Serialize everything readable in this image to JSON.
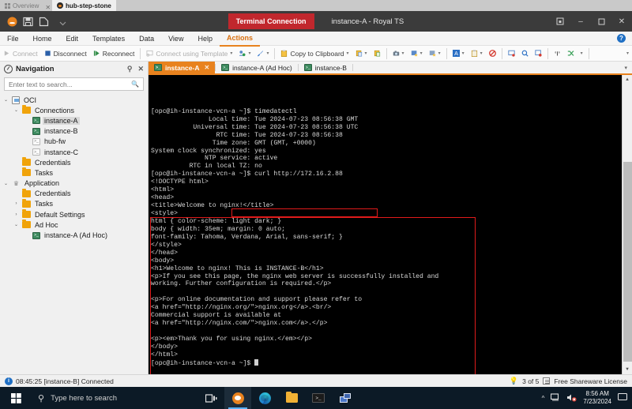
{
  "browser_tabs": [
    {
      "label": "Overview",
      "icon": "grid-icon",
      "active": false
    },
    {
      "label": "hub-step-stone",
      "icon": "app-circle-icon",
      "active": true
    }
  ],
  "window": {
    "connection_badge": "Terminal Connection",
    "title": "instance-A - Royal TS",
    "controls": {
      "restore_down": "❐",
      "minimize": "–",
      "maximize": "❐",
      "close": "✕"
    }
  },
  "quick_access": [
    "royal-ts-logo-icon",
    "save-icon",
    "new-document-icon",
    "customize-caret-icon"
  ],
  "menu": {
    "items": [
      "File",
      "Home",
      "Edit",
      "Templates",
      "Data",
      "View",
      "Help",
      "Actions"
    ],
    "active": "Actions",
    "help_label": "?"
  },
  "ribbon": {
    "connect": "Connect",
    "disconnect": "Disconnect",
    "reconnect": "Reconnect",
    "connect_using_template": "Connect using Template",
    "copy_to_clipboard": "Copy to Clipboard"
  },
  "sidebar": {
    "title": "Navigation",
    "pin_icon": "pin-icon",
    "close_icon": "close-icon",
    "search": {
      "placeholder": "Enter text to search...",
      "value": ""
    },
    "tree": [
      {
        "label": "OCI",
        "depth": 0,
        "chevron": "⌄",
        "icon": "document-icon",
        "selected": false
      },
      {
        "label": "Connections",
        "depth": 1,
        "chevron": "⌄",
        "icon": "folder-icon",
        "selected": false
      },
      {
        "label": "instance-A",
        "depth": 2,
        "chevron": "",
        "icon": "terminal-icon",
        "selected": true
      },
      {
        "label": "instance-B",
        "depth": 2,
        "chevron": "",
        "icon": "terminal-icon",
        "selected": false
      },
      {
        "label": "hub-fw",
        "depth": 2,
        "chevron": "",
        "icon": "terminal-icon-off",
        "selected": false
      },
      {
        "label": "instance-C",
        "depth": 2,
        "chevron": "",
        "icon": "terminal-icon-off",
        "selected": false
      },
      {
        "label": "Credentials",
        "depth": 1,
        "chevron": "",
        "icon": "folder-icon",
        "selected": false
      },
      {
        "label": "Tasks",
        "depth": 1,
        "chevron": "",
        "icon": "folder-icon",
        "selected": false
      },
      {
        "label": "Application",
        "depth": 0,
        "chevron": "⌄",
        "icon": "crown-icon",
        "selected": false
      },
      {
        "label": "Credentials",
        "depth": 1,
        "chevron": "",
        "icon": "folder-icon",
        "selected": false
      },
      {
        "label": "Tasks",
        "depth": 1,
        "chevron": "›",
        "icon": "folder-icon",
        "selected": false
      },
      {
        "label": "Default Settings",
        "depth": 1,
        "chevron": "›",
        "icon": "folder-icon",
        "selected": false
      },
      {
        "label": "Ad Hoc",
        "depth": 1,
        "chevron": "⌄",
        "icon": "folder-icon",
        "selected": false
      },
      {
        "label": "instance-A (Ad Hoc)",
        "depth": 2,
        "chevron": "",
        "icon": "terminal-icon",
        "selected": false
      }
    ]
  },
  "session_tabs": [
    {
      "label": "instance-A",
      "active": true,
      "closable": true,
      "close_glyph": "✕"
    },
    {
      "label": "instance-A (Ad Hoc)",
      "active": false,
      "closable": false
    },
    {
      "label": "instance-B",
      "active": false,
      "closable": false
    }
  ],
  "terminal": {
    "lines": [
      "[opc@ih-instance-vcn-a ~]$ timedatectl",
      "               Local time: Tue 2024-07-23 08:56:38 GMT",
      "           Universal time: Tue 2024-07-23 08:56:38 UTC",
      "                 RTC time: Tue 2024-07-23 08:56:38",
      "                Time zone: GMT (GMT, +0000)",
      "System clock synchronized: yes",
      "              NTP service: active",
      "          RTC in local TZ: no",
      "[opc@ih-instance-vcn-a ~]$ curl http://172.16.2.88",
      "<!DOCTYPE html>",
      "<html>",
      "<head>",
      "<title>Welcome to nginx!</title>",
      "<style>",
      "html { color-scheme: light dark; }",
      "body { width: 35em; margin: 0 auto;",
      "font-family: Tahoma, Verdana, Arial, sans-serif; }",
      "</style>",
      "</head>",
      "<body>",
      "<h1>Welcome to nginx! This is INSTANCE-B</h1>",
      "<p>If you see this page, the nginx web server is successfully installed and",
      "working. Further configuration is required.</p>",
      "",
      "<p>For online documentation and support please refer to",
      "<a href=\"http://nginx.org/\">nginx.org</a>.<br/>",
      "Commercial support is available at",
      "<a href=\"http://nginx.com/\">nginx.com</a>.</p>",
      "",
      "<p><em>Thank you for using nginx.</em></p>",
      "</body>",
      "</html>",
      "[opc@ih-instance-vcn-a ~]$ "
    ],
    "highlight_color": "#e01b1b",
    "annotations": [
      {
        "name": "curl-command-highlight",
        "target": "curl http://172.16.2.88"
      },
      {
        "name": "nginx-response-highlight",
        "target": "html-response-body"
      }
    ]
  },
  "statusbar": {
    "message": "08:45:25 [instance-B] Connected",
    "tip_count": "3 of 5",
    "license": "Free Shareware License"
  },
  "taskbar": {
    "search_placeholder": "Type here to search",
    "clock_time": "8:56 AM",
    "clock_date": "7/23/2024",
    "icons": [
      "task-view-icon",
      "royal-ts-icon",
      "microsoft-edge-icon",
      "file-explorer-icon",
      "command-prompt-icon",
      "network-icon"
    ],
    "tray": [
      "show-hidden-icons-chevron",
      "network-icon",
      "volume-muted-icon",
      "notifications-icon"
    ]
  },
  "colors": {
    "accent_orange": "#e8821e",
    "connection_red": "#c1272d",
    "highlight_red": "#e01b1b",
    "folder_yellow": "#f0a30a",
    "taskbar_blue": "#0c1a26"
  }
}
